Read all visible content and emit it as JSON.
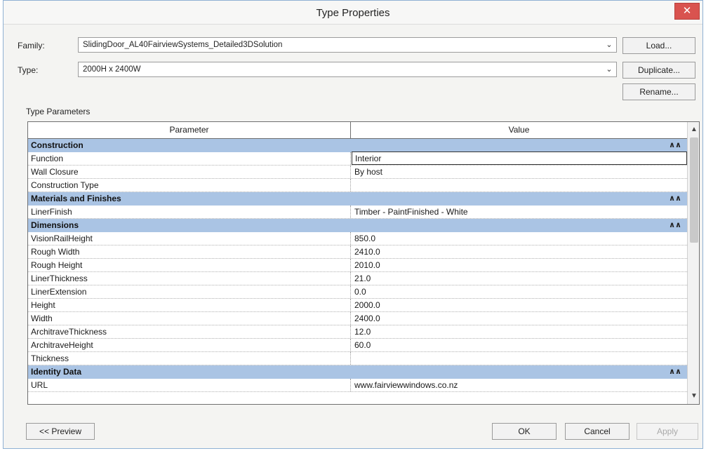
{
  "window": {
    "title": "Type Properties",
    "close_glyph": "✕"
  },
  "family": {
    "label": "Family:",
    "value": "SlidingDoor_AL40FairviewSystems_Detailed3DSolution"
  },
  "type": {
    "label": "Type:",
    "value": "2000H x 2400W"
  },
  "buttons": {
    "load": "Load...",
    "duplicate": "Duplicate...",
    "rename": "Rename...",
    "preview": "<< Preview",
    "ok": "OK",
    "cancel": "Cancel",
    "apply": "Apply"
  },
  "section_label": "Type Parameters",
  "grid": {
    "columns": {
      "parameter": "Parameter",
      "value": "Value"
    },
    "groups": [
      {
        "name": "Construction",
        "rows": [
          {
            "p": "Function",
            "v": "Interior"
          },
          {
            "p": "Wall Closure",
            "v": "By host"
          },
          {
            "p": "Construction Type",
            "v": ""
          }
        ]
      },
      {
        "name": "Materials and Finishes",
        "rows": [
          {
            "p": "LinerFinish",
            "v": "Timber - PaintFinished - White"
          }
        ]
      },
      {
        "name": "Dimensions",
        "rows": [
          {
            "p": "VisionRailHeight",
            "v": "850.0"
          },
          {
            "p": "Rough Width",
            "v": "2410.0"
          },
          {
            "p": "Rough Height",
            "v": "2010.0"
          },
          {
            "p": "LinerThickness",
            "v": "21.0"
          },
          {
            "p": "LinerExtension",
            "v": "0.0"
          },
          {
            "p": "Height",
            "v": "2000.0"
          },
          {
            "p": "Width",
            "v": "2400.0"
          },
          {
            "p": "ArchitraveThickness",
            "v": "12.0"
          },
          {
            "p": "ArchitraveHeight",
            "v": "60.0"
          },
          {
            "p": "Thickness",
            "v": ""
          }
        ]
      },
      {
        "name": "Identity Data",
        "rows": [
          {
            "p": "URL",
            "v": "www.fairviewwindows.co.nz"
          }
        ]
      }
    ]
  },
  "icons": {
    "dropdown": "chevron-down-icon",
    "collapse": "double-chevron-up-icon",
    "scroll_up": "scroll-up-icon",
    "scroll_down": "scroll-down-icon"
  },
  "colors": {
    "group_header": "#aac4e4",
    "close_button": "#d9534f",
    "window_border": "#8fb1d4"
  }
}
